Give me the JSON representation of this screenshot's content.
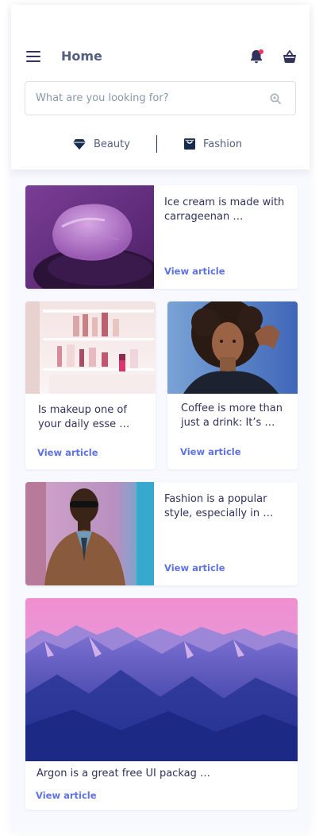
{
  "header": {
    "title": "Home",
    "menu_icon": "hamburger-icon",
    "notification_icon": "bell-icon",
    "cart_icon": "basket-icon",
    "notification_dot_color": "#f5365c"
  },
  "search": {
    "placeholder": "What are you looking for?",
    "value": "",
    "icon": "search-icon"
  },
  "tabs": [
    {
      "label": "Beauty",
      "icon": "diamond-icon"
    },
    {
      "label": "Fashion",
      "icon": "shopping-bag-icon"
    }
  ],
  "articles": [
    {
      "text": "Ice cream is made with carrageenan …",
      "link": "View article",
      "image": "purple cream on spoon"
    },
    {
      "text": "Is makeup one of your daily esse …",
      "link": "View article",
      "image": "makeup products on glass shelf"
    },
    {
      "text": "Coffee is more than just a drink: It’s …",
      "link": "View article",
      "image": "woman with curly hair"
    },
    {
      "text": "Fashion is a popular style, especially in …",
      "link": "View article",
      "image": "man in leather jacket and sunglasses"
    },
    {
      "text": "Argon is a great free UI packag …",
      "link": "View article",
      "image": "purple mountain range"
    }
  ],
  "colors": {
    "primary": "#5e72e4",
    "text": "#32325d",
    "muted": "#8898aa",
    "background": "#f8f9fe"
  }
}
